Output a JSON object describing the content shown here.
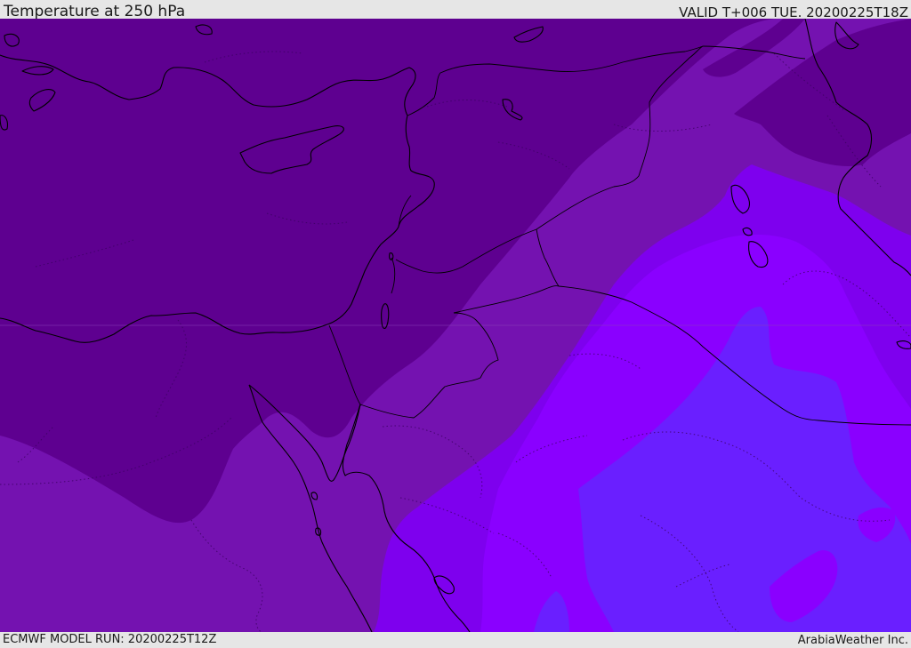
{
  "header": {
    "title": "Temperature at 250 hPa",
    "valid": "VALID T+006 TUE. 20200225T18Z"
  },
  "footer": {
    "model_run": "ECMWF MODEL RUN: 20200225T12Z",
    "credit": "ArabiaWeather Inc."
  },
  "map": {
    "field": "temperature",
    "level": "250 hPa",
    "shading_colors": [
      "#5e0090",
      "#7412b0",
      "#7e00ee",
      "#8a00ff",
      "#6a1fff"
    ]
  }
}
